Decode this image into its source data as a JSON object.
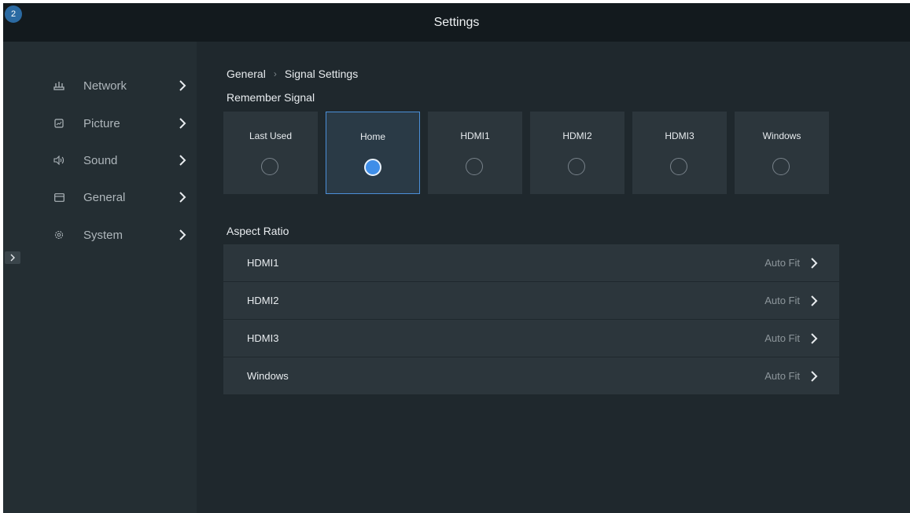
{
  "header": {
    "title": "Settings",
    "badge": "2"
  },
  "sidebar": {
    "items": [
      {
        "label": "Network",
        "icon": "router-icon"
      },
      {
        "label": "Picture",
        "icon": "picture-icon"
      },
      {
        "label": "Sound",
        "icon": "speaker-icon"
      },
      {
        "label": "General",
        "icon": "window-icon"
      },
      {
        "label": "System",
        "icon": "gear-icon"
      }
    ]
  },
  "breadcrumb": {
    "parent": "General",
    "separator": "›",
    "current": "Signal Settings"
  },
  "remember_signal": {
    "title": "Remember Signal",
    "options": [
      {
        "label": "Last Used",
        "selected": false
      },
      {
        "label": "Home",
        "selected": true
      },
      {
        "label": "HDMI1",
        "selected": false
      },
      {
        "label": "HDMI2",
        "selected": false
      },
      {
        "label": "HDMI3",
        "selected": false
      },
      {
        "label": "Windows",
        "selected": false
      }
    ]
  },
  "aspect_ratio": {
    "title": "Aspect Ratio",
    "rows": [
      {
        "label": "HDMI1",
        "value": "Auto Fit"
      },
      {
        "label": "HDMI2",
        "value": "Auto Fit"
      },
      {
        "label": "HDMI3",
        "value": "Auto Fit"
      },
      {
        "label": "Windows",
        "value": "Auto Fit"
      }
    ]
  },
  "colors": {
    "accent": "#3f8ee8",
    "background": "#1f282d",
    "sidebar": "#242e33",
    "header": "#131a1e"
  }
}
